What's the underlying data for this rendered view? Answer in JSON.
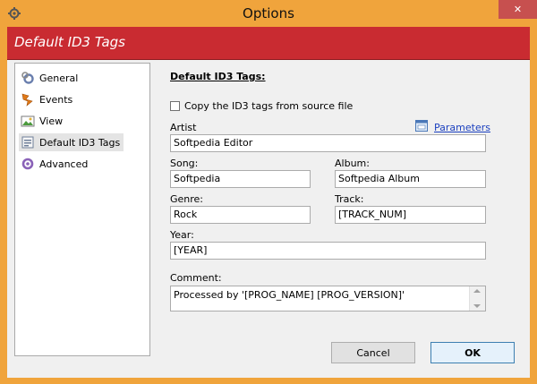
{
  "window": {
    "title": "Options",
    "close_label": "✕"
  },
  "banner": {
    "title": "Default ID3 Tags"
  },
  "sidebar": {
    "items": [
      {
        "label": "General",
        "icon": "gear-icon",
        "selected": false
      },
      {
        "label": "Events",
        "icon": "events-icon",
        "selected": false
      },
      {
        "label": "View",
        "icon": "view-icon",
        "selected": false
      },
      {
        "label": "Default ID3 Tags",
        "icon": "tags-icon",
        "selected": true
      },
      {
        "label": "Advanced",
        "icon": "advanced-gear-icon",
        "selected": false
      }
    ]
  },
  "form": {
    "heading": "Default ID3 Tags:",
    "copy_checkbox": {
      "label": "Copy the ID3 tags from source file",
      "checked": false
    },
    "parameters_link": "Parameters",
    "artist": {
      "label": "Artist",
      "value": "Softpedia Editor"
    },
    "song": {
      "label": "Song:",
      "value": "Softpedia"
    },
    "album": {
      "label": "Album:",
      "value": "Softpedia Album"
    },
    "genre": {
      "label": "Genre:",
      "value": "Rock"
    },
    "track": {
      "label": "Track:",
      "value": "[TRACK_NUM]"
    },
    "year": {
      "label": "Year:",
      "value": "[YEAR]"
    },
    "comment": {
      "label": "Comment:",
      "value": "Processed by '[PROG_NAME] [PROG_VERSION]'"
    }
  },
  "buttons": {
    "cancel": "Cancel",
    "ok": "OK"
  },
  "colors": {
    "accent": "#c92b31",
    "titlebar": "#f0a43c",
    "link": "#1a3fbf"
  }
}
